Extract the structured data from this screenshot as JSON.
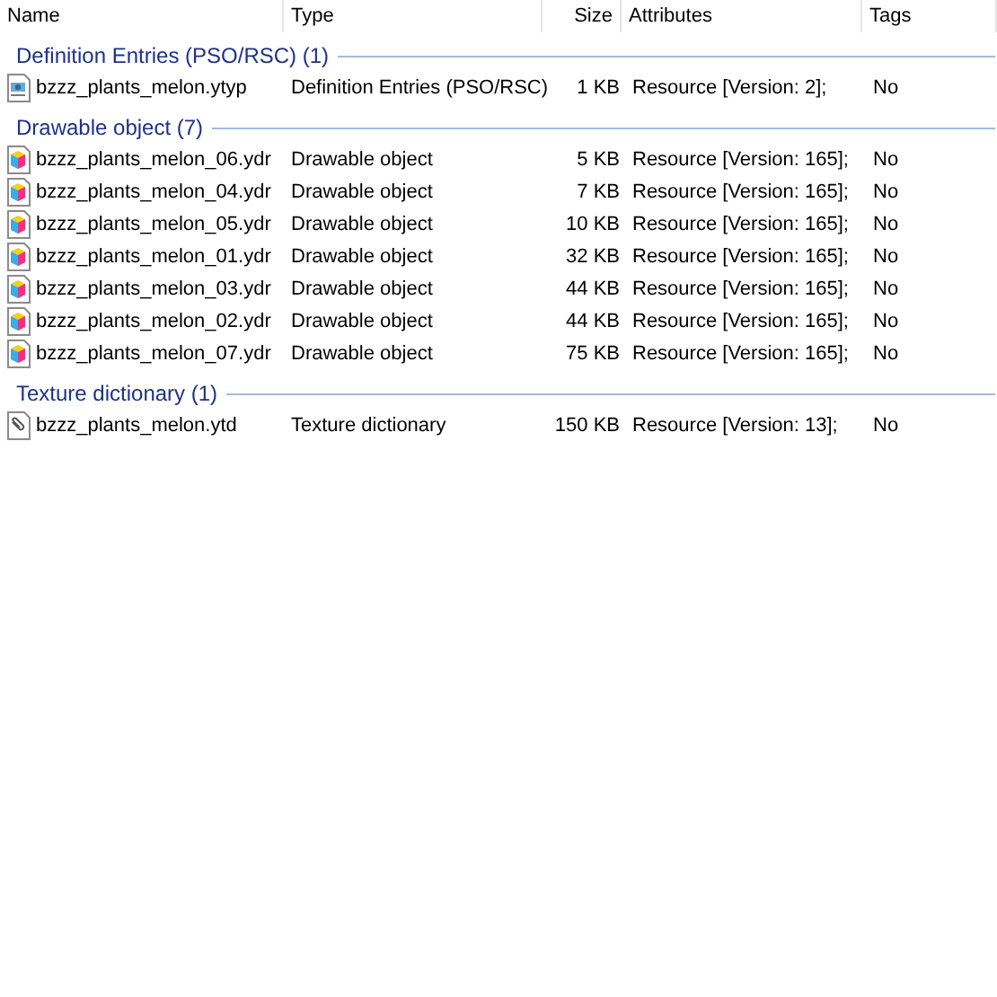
{
  "columns": [
    "Name",
    "Type",
    "Size",
    "Attributes",
    "Tags"
  ],
  "groups": [
    {
      "title": "Definition Entries (PSO/RSC) (1)",
      "files": [
        {
          "name": "bzzz_plants_melon.ytyp",
          "kind": "definition",
          "type": "Definition Entries (PSO/RSC)",
          "size": "1 KB",
          "attributes": "Resource [Version: 2];",
          "tags": "No"
        }
      ]
    },
    {
      "title": "Drawable object (7)",
      "files": [
        {
          "name": "bzzz_plants_melon_06.ydr",
          "kind": "drawable",
          "type": "Drawable object",
          "size": "5 KB",
          "attributes": "Resource [Version: 165];",
          "tags": "No"
        },
        {
          "name": "bzzz_plants_melon_04.ydr",
          "kind": "drawable",
          "type": "Drawable object",
          "size": "7 KB",
          "attributes": "Resource [Version: 165];",
          "tags": "No"
        },
        {
          "name": "bzzz_plants_melon_05.ydr",
          "kind": "drawable",
          "type": "Drawable object",
          "size": "10 KB",
          "attributes": "Resource [Version: 165];",
          "tags": "No"
        },
        {
          "name": "bzzz_plants_melon_01.ydr",
          "kind": "drawable",
          "type": "Drawable object",
          "size": "32 KB",
          "attributes": "Resource [Version: 165];",
          "tags": "No"
        },
        {
          "name": "bzzz_plants_melon_03.ydr",
          "kind": "drawable",
          "type": "Drawable object",
          "size": "44 KB",
          "attributes": "Resource [Version: 165];",
          "tags": "No"
        },
        {
          "name": "bzzz_plants_melon_02.ydr",
          "kind": "drawable",
          "type": "Drawable object",
          "size": "44 KB",
          "attributes": "Resource [Version: 165];",
          "tags": "No"
        },
        {
          "name": "bzzz_plants_melon_07.ydr",
          "kind": "drawable",
          "type": "Drawable object",
          "size": "75 KB",
          "attributes": "Resource [Version: 165];",
          "tags": "No"
        }
      ]
    },
    {
      "title": "Texture dictionary (1)",
      "files": [
        {
          "name": "bzzz_plants_melon.ytd",
          "kind": "texture",
          "type": "Texture dictionary",
          "size": "150 KB",
          "attributes": "Resource [Version: 13];",
          "tags": "No"
        }
      ]
    }
  ]
}
